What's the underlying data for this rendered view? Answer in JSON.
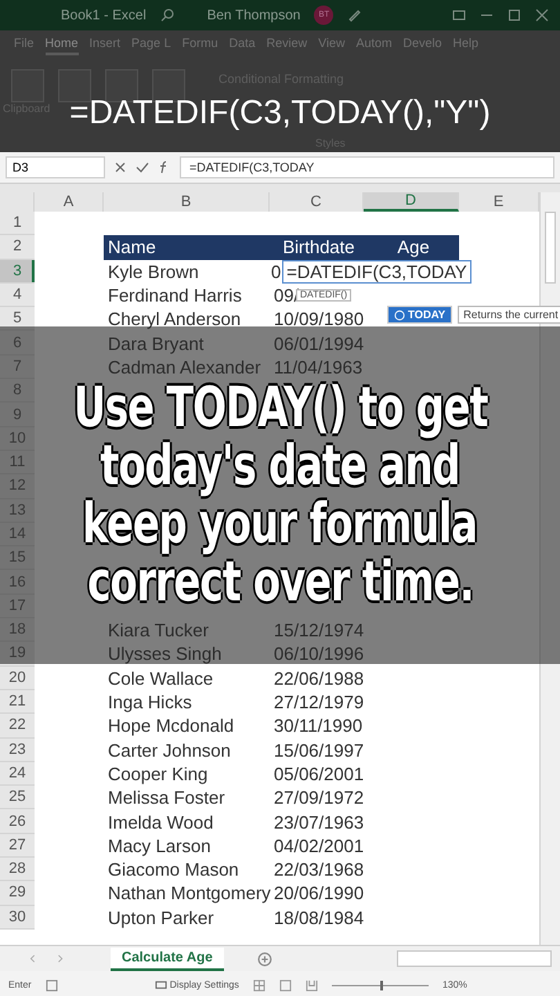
{
  "title_bar": {
    "title": "Book1 - Excel",
    "user": "Ben Thompson",
    "initials": "BT"
  },
  "ribbon": {
    "tabs": [
      {
        "label": "File",
        "selected": false
      },
      {
        "label": "Home",
        "selected": true
      },
      {
        "label": "Insert",
        "selected": false
      },
      {
        "label": "Page L",
        "selected": false
      },
      {
        "label": "Formu",
        "selected": false
      },
      {
        "label": "Data",
        "selected": false
      },
      {
        "label": "Review",
        "selected": false
      },
      {
        "label": "View",
        "selected": false
      },
      {
        "label": "Autom",
        "selected": false
      },
      {
        "label": "Develo",
        "selected": false
      },
      {
        "label": "Help",
        "selected": false
      }
    ],
    "clipboard_label": "Clipboard",
    "conditional_formatting": "Conditional Formatting",
    "styles_label": "Styles"
  },
  "top_caption": "=DATEDIF(C3,TODAY(),\"Y\")",
  "formula_bar": {
    "name_box": "D3",
    "formula": "=DATEDIF(C3,TODAY"
  },
  "columns": [
    {
      "label": "A",
      "selected": false
    },
    {
      "label": "B",
      "selected": false
    },
    {
      "label": "C",
      "selected": false
    },
    {
      "label": "D",
      "selected": true
    },
    {
      "label": "E",
      "selected": false
    }
  ],
  "rows": [
    {
      "number": "1",
      "kind": "empty",
      "selected": false
    },
    {
      "number": "2",
      "kind": "header",
      "selected": false,
      "name": "Name",
      "birthdate": "Birthdate",
      "age": "Age"
    },
    {
      "number": "3",
      "kind": "editing",
      "selected": true,
      "name": "Kyle Brown",
      "birthdate": "0",
      "edit_text": "=DATEDIF(C3,TODAY"
    },
    {
      "number": "4",
      "kind": "data",
      "selected": false,
      "name": "Ferdinand Harris",
      "birthdate": "09/"
    },
    {
      "number": "5",
      "kind": "data",
      "selected": false,
      "name": "Cheryl Anderson",
      "birthdate": "10/09/1980"
    },
    {
      "number": "6",
      "kind": "data",
      "selected": false,
      "name": "Dara Bryant",
      "birthdate": "06/01/1994"
    },
    {
      "number": "7",
      "kind": "data",
      "selected": false,
      "name": "Cadman Alexander",
      "birthdate": "11/04/1963"
    },
    {
      "number": "8",
      "kind": "empty",
      "selected": false
    },
    {
      "number": "9",
      "kind": "empty",
      "selected": false
    },
    {
      "number": "10",
      "kind": "empty",
      "selected": false
    },
    {
      "number": "11",
      "kind": "empty",
      "selected": false
    },
    {
      "number": "12",
      "kind": "empty",
      "selected": false
    },
    {
      "number": "13",
      "kind": "empty",
      "selected": false
    },
    {
      "number": "14",
      "kind": "empty",
      "selected": false
    },
    {
      "number": "15",
      "kind": "empty",
      "selected": false
    },
    {
      "number": "16",
      "kind": "empty",
      "selected": false
    },
    {
      "number": "17",
      "kind": "empty",
      "selected": false
    },
    {
      "number": "18",
      "kind": "data",
      "selected": false,
      "name": "Kiara Tucker",
      "birthdate": "15/12/1974"
    },
    {
      "number": "19",
      "kind": "data",
      "selected": false,
      "name": "Ulysses Singh",
      "birthdate": "06/10/1996"
    },
    {
      "number": "20",
      "kind": "data",
      "selected": false,
      "name": "Cole Wallace",
      "birthdate": "22/06/1988"
    },
    {
      "number": "21",
      "kind": "data",
      "selected": false,
      "name": "Inga Hicks",
      "birthdate": "27/12/1979"
    },
    {
      "number": "22",
      "kind": "data",
      "selected": false,
      "name": "Hope Mcdonald",
      "birthdate": "30/11/1990"
    },
    {
      "number": "23",
      "kind": "data",
      "selected": false,
      "name": "Carter Johnson",
      "birthdate": "15/06/1997"
    },
    {
      "number": "24",
      "kind": "data",
      "selected": false,
      "name": "Cooper King",
      "birthdate": "05/06/2001"
    },
    {
      "number": "25",
      "kind": "data",
      "selected": false,
      "name": "Melissa Foster",
      "birthdate": "27/09/1972"
    },
    {
      "number": "26",
      "kind": "data",
      "selected": false,
      "name": "Imelda Wood",
      "birthdate": "23/07/1963"
    },
    {
      "number": "27",
      "kind": "data",
      "selected": false,
      "name": "Macy Larson",
      "birthdate": "04/02/2001"
    },
    {
      "number": "28",
      "kind": "data",
      "selected": false,
      "name": "Giacomo Mason",
      "birthdate": "22/03/1968"
    },
    {
      "number": "29",
      "kind": "data",
      "selected": false,
      "name": "Nathan Montgomery",
      "birthdate": "20/06/1990"
    },
    {
      "number": "30",
      "kind": "data",
      "selected": false,
      "name": "Upton Parker",
      "birthdate": "18/08/1984"
    }
  ],
  "function_tip": "DATEDIF()",
  "autocomplete": {
    "item": "TODAY",
    "description": "Returns the current"
  },
  "caption_lines": [
    "Use TODAY() to get",
    "today's date and",
    "keep your formula",
    "correct over time."
  ],
  "sheet_tabs": [
    {
      "label": "Calculate Age",
      "selected": true
    }
  ],
  "status_bar": {
    "mode": "Enter",
    "display_settings": "Display Settings",
    "zoom": "130%",
    "level": 0.5
  }
}
